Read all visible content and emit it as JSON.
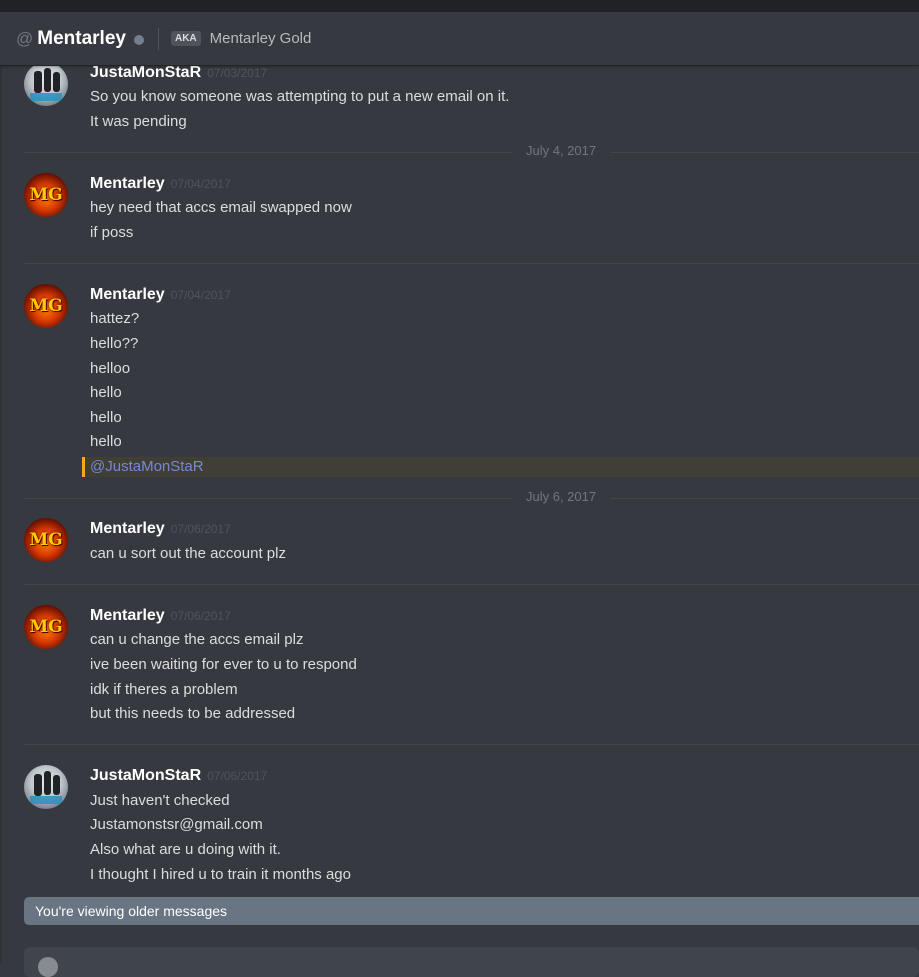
{
  "header": {
    "at_symbol": "@",
    "username": "Mentarley",
    "aka_label": "AKA",
    "aka_name": "Mentarley Gold"
  },
  "avatars": {
    "mg_initials": "MG"
  },
  "messages": [
    {
      "author": "JustaMonStaR",
      "timestamp": "07/03/2017",
      "lines": [
        "So you know someone was attempting to put a new email on it.",
        "It was pending"
      ]
    },
    {
      "author": "Mentarley",
      "timestamp": "07/04/2017",
      "lines": [
        "hey need that accs email swapped now",
        "if poss"
      ]
    },
    {
      "author": "Mentarley",
      "timestamp": "07/04/2017",
      "lines": [
        "hattez?",
        "hello??",
        "helloo",
        "hello",
        "hello",
        "hello"
      ],
      "mention": "@JustaMonStaR"
    },
    {
      "author": "Mentarley",
      "timestamp": "07/06/2017",
      "lines": [
        "can u sort out the account plz"
      ]
    },
    {
      "author": "Mentarley",
      "timestamp": "07/06/2017",
      "lines": [
        "can u change the accs email plz",
        "ive been waiting for ever to u to respond",
        "idk if theres a problem",
        "but this needs to be addressed"
      ]
    },
    {
      "author": "JustaMonStaR",
      "timestamp": "07/06/2017",
      "lines": [
        "Just haven't checked",
        "Justamonstsr@gmail.com",
        "Also what are u doing with it.",
        "I thought I hired u to train it months ago"
      ]
    }
  ],
  "dividers": {
    "d1": "July 4, 2017",
    "d2": "July 6, 2017"
  },
  "older_notice": "You're viewing older messages",
  "colors": {
    "background": "#36393f",
    "mention_accent": "#faa61a",
    "mention_text": "#7289da",
    "notice_bar": "#697583"
  }
}
